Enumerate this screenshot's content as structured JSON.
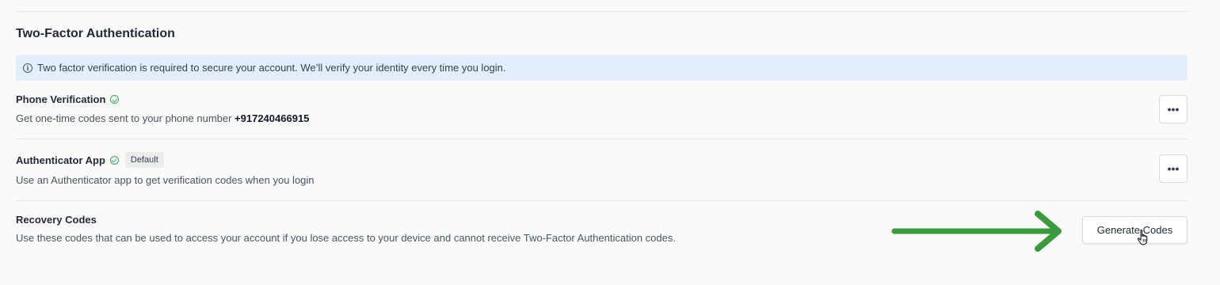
{
  "section": {
    "title": "Two-Factor Authentication",
    "banner": "Two factor verification is required to secure your account. We’ll verify your identity every time you login."
  },
  "phone": {
    "title": "Phone Verification",
    "desc_prefix": "Get one-time codes sent to your phone number",
    "phone_number": "+917240466915",
    "more": "•••"
  },
  "authenticator": {
    "title": "Authenticator App",
    "badge": "Default",
    "desc": "Use an Authenticator app to get verification codes when you login",
    "more": "•••"
  },
  "recovery": {
    "title": "Recovery Codes",
    "desc": "Use these codes that can be used to access your account if you lose access to your device and cannot receive Two-Factor Authentication codes.",
    "button": "Generate Codes"
  },
  "colors": {
    "banner_bg": "#e3f0fb",
    "check": "#3aa85a",
    "annotation_arrow": "#3a9b3e"
  },
  "icons": {
    "banner": "info-icon",
    "verified": "check-circle-icon",
    "more": "ellipsis-icon",
    "pointer": "hand-cursor-icon"
  }
}
